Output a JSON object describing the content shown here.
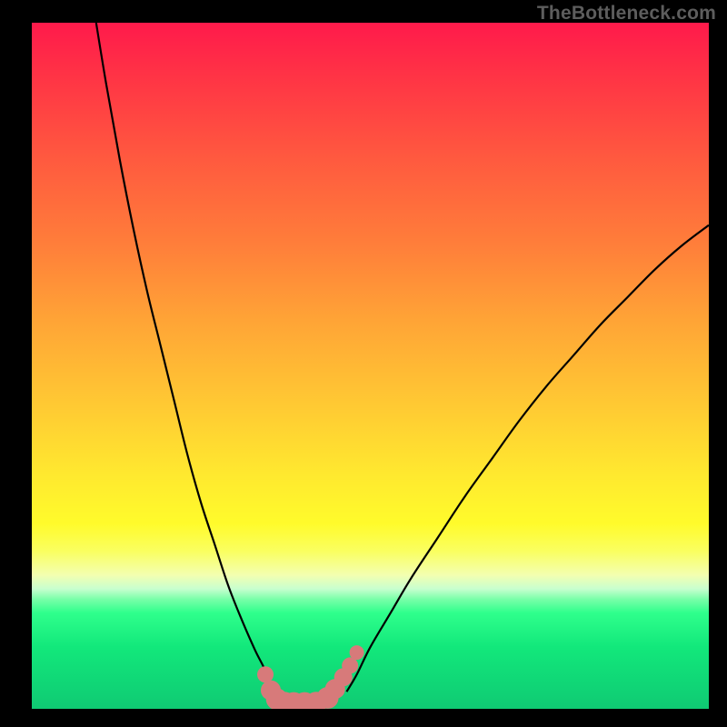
{
  "attribution": "TheBottleneck.com",
  "colors": {
    "curve": "#000000",
    "marker_fill": "#d77a7a",
    "marker_stroke": "#c26666",
    "frame": "#000000"
  },
  "chart_data": {
    "type": "line",
    "title": "",
    "xlabel": "",
    "ylabel": "",
    "xlim": [
      0,
      100
    ],
    "ylim": [
      0,
      100
    ],
    "grid": false,
    "legend": false,
    "series": [
      {
        "name": "left-arm",
        "x": [
          9.5,
          11,
          13,
          15,
          17,
          19,
          21,
          23,
          25,
          27,
          29,
          31,
          33,
          34.5,
          35.3
        ],
        "y": [
          100,
          91,
          80,
          70,
          61,
          53,
          45,
          37,
          30,
          24,
          18,
          13,
          8.5,
          5.5,
          2.5
        ]
      },
      {
        "name": "right-arm",
        "x": [
          46.5,
          48,
          50,
          53,
          56,
          60,
          64,
          68,
          72,
          76,
          80,
          84,
          88,
          92,
          96,
          100
        ],
        "y": [
          2.5,
          5,
          9,
          14,
          19,
          25,
          31,
          36.5,
          42,
          47,
          51.5,
          56,
          60,
          64,
          67.5,
          70.5
        ]
      },
      {
        "name": "marker-trail",
        "x": [
          34.5,
          35.3,
          36.2,
          37.3,
          38.7,
          40.3,
          42.0,
          43.7,
          44.8,
          46.0,
          47.0,
          48.0
        ],
        "y": [
          5.0,
          2.7,
          1.4,
          0.9,
          0.85,
          0.85,
          0.9,
          1.6,
          2.9,
          4.6,
          6.3,
          8.2
        ]
      }
    ]
  },
  "markers": {
    "points": [
      {
        "x": 34.5,
        "y": 5.0,
        "r": 9
      },
      {
        "x": 35.3,
        "y": 2.7,
        "r": 11
      },
      {
        "x": 36.2,
        "y": 1.4,
        "r": 12
      },
      {
        "x": 37.3,
        "y": 0.9,
        "r": 12
      },
      {
        "x": 38.7,
        "y": 0.85,
        "r": 12
      },
      {
        "x": 40.3,
        "y": 0.85,
        "r": 12
      },
      {
        "x": 42.0,
        "y": 0.9,
        "r": 12
      },
      {
        "x": 43.7,
        "y": 1.6,
        "r": 12
      },
      {
        "x": 44.8,
        "y": 2.9,
        "r": 11
      },
      {
        "x": 46.0,
        "y": 4.6,
        "r": 10
      },
      {
        "x": 47.0,
        "y": 6.3,
        "r": 9
      },
      {
        "x": 48.0,
        "y": 8.2,
        "r": 8
      }
    ]
  }
}
